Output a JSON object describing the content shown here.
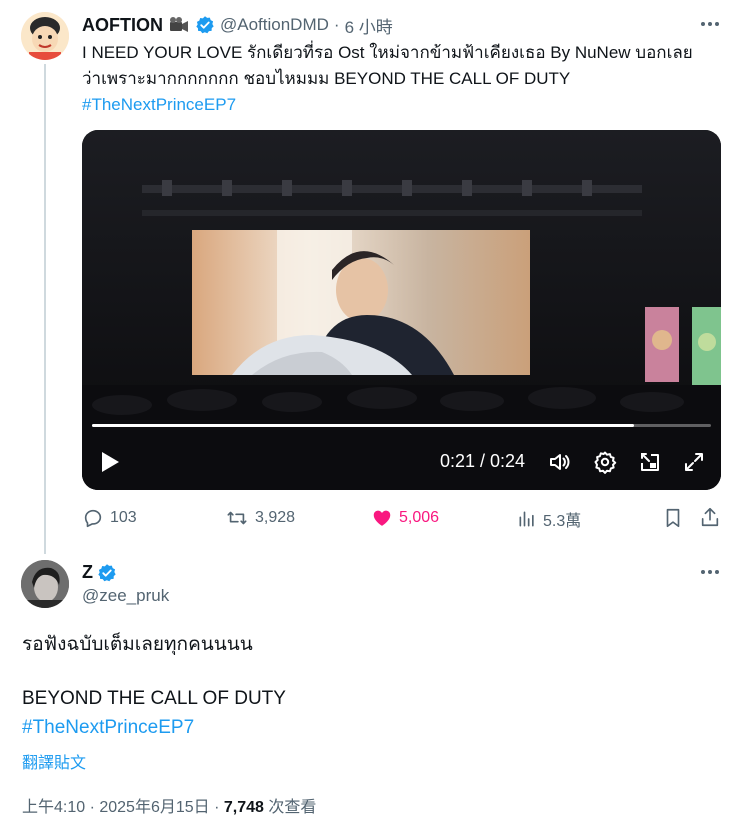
{
  "tweet1": {
    "display_name": "AOFTION",
    "handle": "@AoftionDMD",
    "separator": "·",
    "time": "6 小時",
    "text_line1": "I NEED YOUR LOVE รักเดียวที่รอ Ost ใหม่จากข้ามฟ้าเคียงเธอ By NuNew บอกเลย",
    "text_line2": "ว่าเพราะมากกกกกกก ชอบไหมมม BEYOND THE CALL OF DUTY",
    "hashtag": "#TheNextPrinceEP7",
    "video": {
      "time_label": "0:21 / 0:24",
      "progress": 0.875
    },
    "actions": {
      "replies": "103",
      "retweets": "3,928",
      "likes": "5,006",
      "views": "5.3萬"
    }
  },
  "tweet2": {
    "display_name": "Z",
    "handle": "@zee_pruk",
    "text_line1": "รอฟังฉบับเต็มเลยทุกคนนนน",
    "text_line2": "BEYOND THE CALL OF DUTY",
    "hashtag": "#TheNextPrinceEP7",
    "translate": "翻譯貼文",
    "meta_time": "上午4:10 · 2025年6月15日 · ",
    "meta_views": "7,748",
    "meta_views_suffix": " 次查看"
  },
  "colors": {
    "accent": "#1d9bf0",
    "like": "#f91880",
    "muted": "#536471"
  },
  "icons": [
    "camera-emoji-icon",
    "verified-badge-icon",
    "more-icon",
    "reply-icon",
    "retweet-icon",
    "heart-icon",
    "views-icon",
    "bookmark-icon",
    "share-icon",
    "play-icon",
    "volume-icon",
    "settings-icon",
    "pip-icon",
    "fullscreen-icon"
  ]
}
